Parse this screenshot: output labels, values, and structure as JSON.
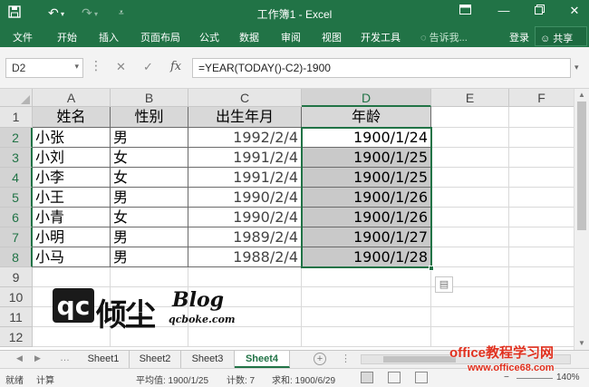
{
  "window": {
    "title": "工作簿1 - Excel",
    "qat": {
      "save_icon": "save-icon",
      "undo_icon": "undo-icon",
      "redo_icon": "redo-icon",
      "customize_icon": "customize-qat-icon"
    },
    "controls": {
      "ribbon_display_icon": "ribbon-display-options-icon",
      "minimize_icon": "minimize-icon",
      "restore_icon": "restore-icon",
      "close_icon": "close-icon"
    }
  },
  "ribbon": {
    "tabs": [
      "文件",
      "开始",
      "插入",
      "页面布局",
      "公式",
      "数据",
      "审阅",
      "视图",
      "开发工具"
    ],
    "tell_me": "告诉我...",
    "sign_in": "登录",
    "share": "共享"
  },
  "formula_bar": {
    "name_box": "D2",
    "formula": "=YEAR(TODAY()-C2)-1900",
    "cancel_icon": "cancel-icon",
    "enter_icon": "enter-icon",
    "function_icon": "fx"
  },
  "sheet": {
    "columns": [
      "A",
      "B",
      "C",
      "D",
      "E",
      "F"
    ],
    "rows": [
      "1",
      "2",
      "3",
      "4",
      "5",
      "6",
      "7",
      "8",
      "9",
      "10",
      "11",
      "12"
    ],
    "selected_column": "D",
    "headers": {
      "name": "姓名",
      "gender": "性别",
      "birth": "出生年月",
      "age": "年龄"
    },
    "records": [
      {
        "name": "小张",
        "gender": "男",
        "birth": "1992/2/4",
        "age": "1900/1/24"
      },
      {
        "name": "小刘",
        "gender": "女",
        "birth": "1991/2/4",
        "age": "1900/1/25"
      },
      {
        "name": "小李",
        "gender": "女",
        "birth": "1991/2/4",
        "age": "1900/1/25"
      },
      {
        "name": "小王",
        "gender": "男",
        "birth": "1990/2/4",
        "age": "1900/1/26"
      },
      {
        "name": "小青",
        "gender": "女",
        "birth": "1990/2/4",
        "age": "1900/1/26"
      },
      {
        "name": "小明",
        "gender": "男",
        "birth": "1989/2/4",
        "age": "1900/1/27"
      },
      {
        "name": "小马",
        "gender": "男",
        "birth": "1988/2/4",
        "age": "1900/1/28"
      }
    ]
  },
  "logo": {
    "letters": "qc",
    "chinese": "倾尘",
    "blog": "Blog",
    "site": "qcboke.com"
  },
  "sheet_tabs": [
    "Sheet1",
    "Sheet2",
    "Sheet3",
    "Sheet4"
  ],
  "active_sheet": "Sheet4",
  "status_bar": {
    "mode": "就绪",
    "calc": "计算",
    "average": "平均值: 1900/1/25",
    "count": "计数: 7",
    "sum": "求和: 1900/6/29",
    "zoom": "140%"
  },
  "watermark": {
    "title": "office教程学习网",
    "url": "www.office68.com"
  },
  "colors": {
    "excel_green": "#217346",
    "header_gray": "#d8d8d8",
    "selection_fill": "#c9c9c9",
    "watermark_red": "#e0301e"
  }
}
